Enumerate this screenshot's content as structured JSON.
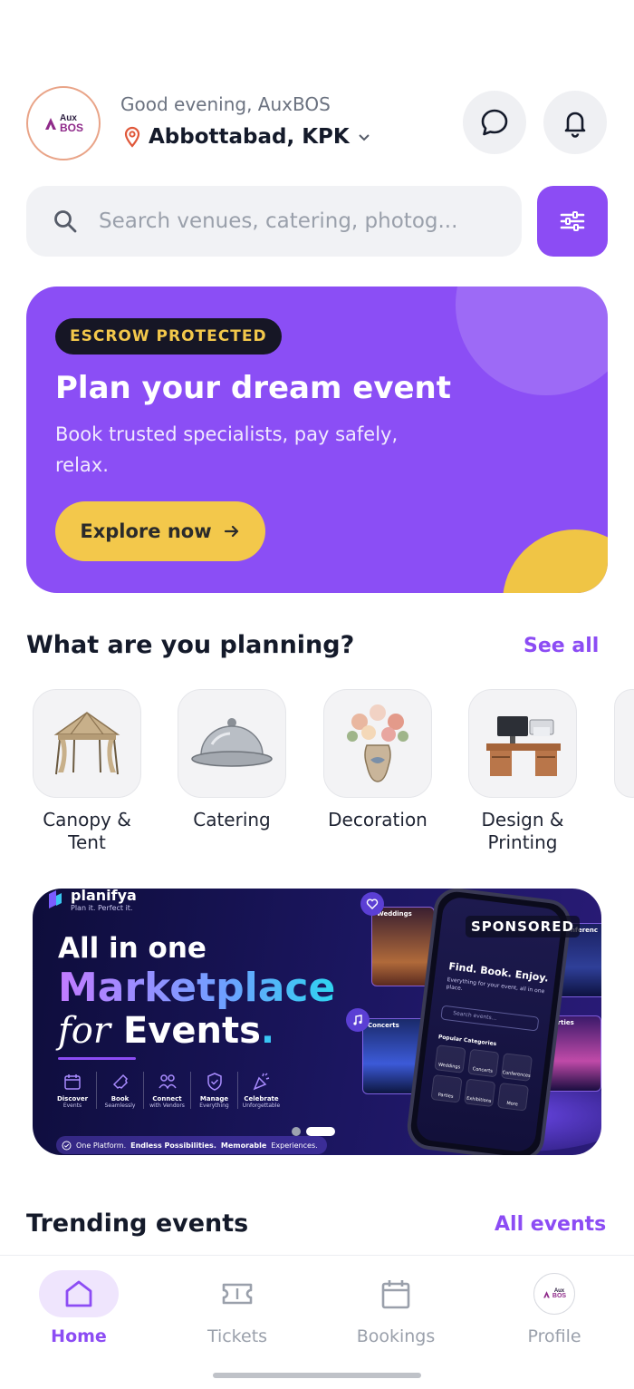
{
  "header": {
    "greeting": "Good evening, AuxBOS",
    "location": "Abbottabad, KPK",
    "logo_line1": "Aux",
    "logo_line2": "BOS"
  },
  "search": {
    "placeholder": "Search venues, catering, photog..."
  },
  "hero": {
    "badge": "ESCROW PROTECTED",
    "title": "Plan your dream event",
    "subtitle": "Book trusted specialists, pay safely, relax.",
    "cta": "Explore now"
  },
  "planning": {
    "title": "What are you planning?",
    "see_all": "See all",
    "categories": [
      {
        "line1": "Canopy &",
        "line2": "Tent"
      },
      {
        "line1": "Catering",
        "line2": ""
      },
      {
        "line1": "Decoration",
        "line2": ""
      },
      {
        "line1": "Design &",
        "line2": "Printing"
      }
    ]
  },
  "banner": {
    "brand_name": "planifya",
    "brand_tagline": "Plan it. Perfect it.",
    "line1": "All in one",
    "line2": "Marketplace",
    "line3_for": "for",
    "line3_events": "Events",
    "line3_dot": ".",
    "sponsored": "SPONSORED",
    "features": [
      {
        "title": "Discover",
        "sub": "Events"
      },
      {
        "title": "Book",
        "sub": "Seamlessly"
      },
      {
        "title": "Connect",
        "sub": "with Vendors"
      },
      {
        "title": "Manage",
        "sub": "Everything"
      },
      {
        "title": "Celebrate",
        "sub": "Unforgettable"
      }
    ],
    "footer_a": "One Platform.",
    "footer_b": "Endless Possibilities.",
    "footer_c": "Memorable",
    "footer_d": "Experiences.",
    "phone_title": "Find. Book. Enjoy.",
    "phone_sub": "Everything for your event, all in one place.",
    "phone_search": "Search events...",
    "phone_categories": "Popular Categories",
    "phone_grid": [
      "Weddings",
      "Concerts",
      "Conferences",
      "Parties",
      "Exhibitions",
      "More"
    ],
    "card_weddings": "Weddings",
    "card_concerts": "Concerts",
    "card_conferences": "Conferenc",
    "card_parties": "Parties",
    "active_slide": 2,
    "slide_count": 2
  },
  "trending": {
    "title": "Trending events",
    "link": "All events"
  },
  "nav": {
    "items": [
      {
        "label": "Home",
        "icon": "home-icon",
        "active": true
      },
      {
        "label": "Tickets",
        "icon": "ticket-icon",
        "active": false
      },
      {
        "label": "Bookings",
        "icon": "calendar-icon",
        "active": false
      },
      {
        "label": "Profile",
        "icon": "avatar",
        "active": false
      }
    ]
  },
  "colors": {
    "accent": "#8c4cf4",
    "hero_bg": "#8b4ef5",
    "yellow": "#f3c84b",
    "text": "#141a2a"
  }
}
